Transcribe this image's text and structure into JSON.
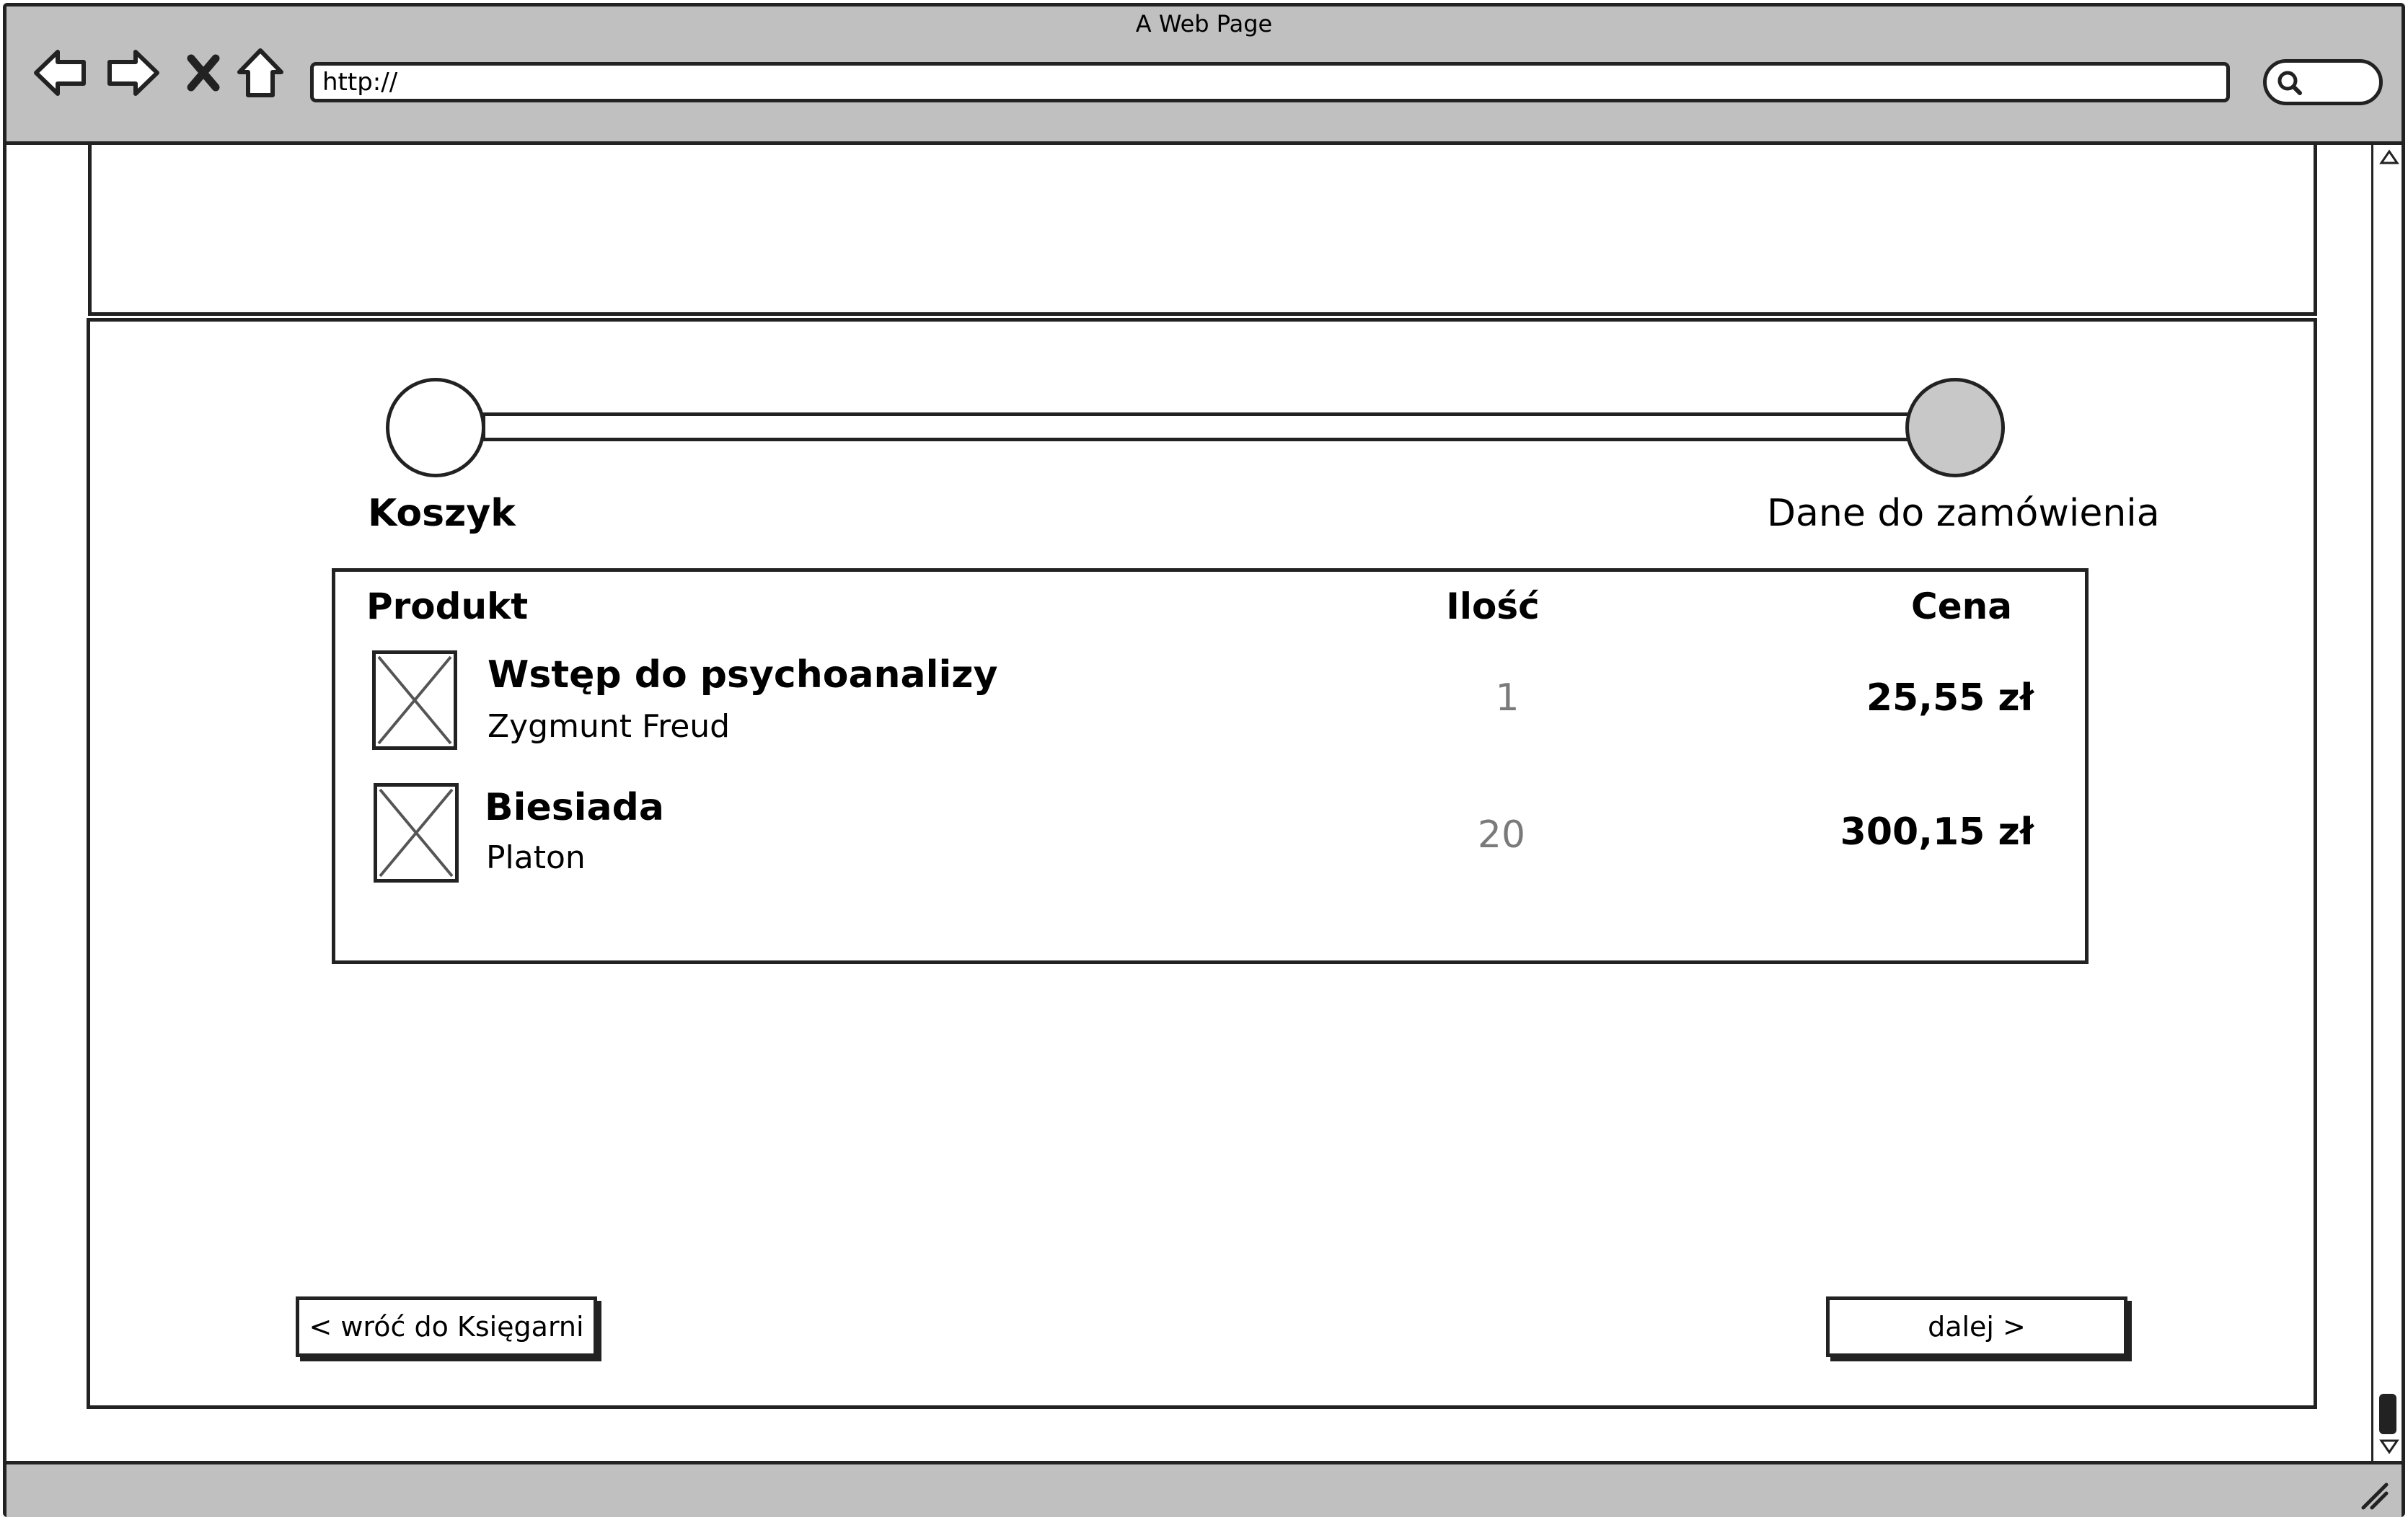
{
  "browser": {
    "title": "A Web Page",
    "url": "http://",
    "icons": [
      "back-arrow-icon",
      "forward-arrow-icon",
      "close-icon",
      "home-icon",
      "search-icon"
    ]
  },
  "stepper": {
    "steps": [
      {
        "label": "Koszyk",
        "active": true
      },
      {
        "label": "Dane do zamówienia",
        "active": false
      }
    ]
  },
  "cart": {
    "headers": {
      "product": "Produkt",
      "quantity": "Ilość",
      "price": "Cena"
    },
    "items": [
      {
        "title": "Wstęp do psychoanalizy",
        "author": "Zygmunt Freud",
        "quantity": "1",
        "price": "25,55 zł"
      },
      {
        "title": "Biesiada",
        "author": "Platon",
        "quantity": "20",
        "price": "300,15 zł"
      }
    ]
  },
  "buttons": {
    "back": "< wróć do Księgarni",
    "next": "dalej >"
  },
  "colors": {
    "frame": "#c0c0c0",
    "border": "#222222",
    "muted_text": "#7a7a7a"
  }
}
